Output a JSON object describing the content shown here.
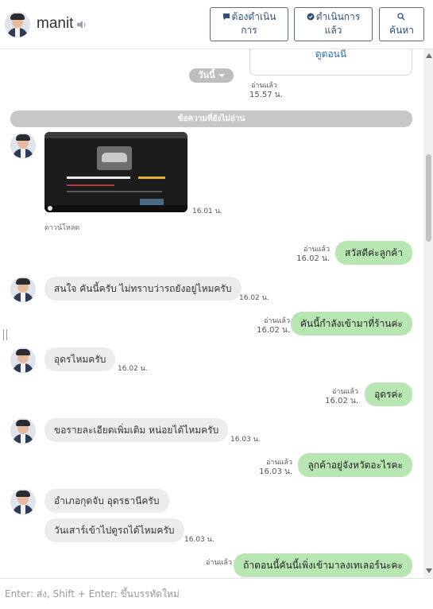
{
  "header": {
    "contact_name": "manit",
    "buttons": {
      "todo": [
        "ต้องดำเนิน",
        "การ"
      ],
      "done": [
        "ดำเนินการ",
        "แล้ว"
      ],
      "search": "ค้นหา"
    }
  },
  "chat": {
    "top_card_link": "ดูตอนนี้",
    "date_pill": "วันนี้",
    "top_read": "อ่านแล้ว",
    "top_time": "15.57 น.",
    "unread_divider": "ข้อความที่ยังไม่อ่าน",
    "image_time": "16.01 น.",
    "download_label": "ดาวน์โหลด",
    "messages": [
      {
        "text": "สวัสดีค่ะลูกค้า",
        "read": "อ่านแล้ว",
        "time": "16.02 น."
      },
      {
        "text": "สนใจ คันนี้ครับ ไม่ทราบว่ารถยังอยู่ไหมครับ",
        "time": "16.02 น."
      },
      {
        "text": "คันนี้กำลังเข้ามาที่ร้านค่ะ",
        "read": "อ่านแล้ว",
        "time": "16.02 น."
      },
      {
        "text": "อุดรไหมครับ",
        "time": "16.02 น."
      },
      {
        "text": "อุดรค่ะ",
        "read": "อ่านแล้ว",
        "time": "16.02 น."
      },
      {
        "text": "ขอรายละเอียดเพิ่มเติม หน่อยได้ไหมครับ",
        "time": "16.03 น."
      },
      {
        "text": "ลูกค้าอยู่จังหวัดอะไรคะ",
        "read": "อ่านแล้ว",
        "time": "16.03 น."
      },
      {
        "text": "อำเภอกุดจับ อุดรธานีครับ"
      },
      {
        "text": "วันเสาร์เข้าไปดูรถได้ไหมครับ",
        "time": "16.03 น."
      },
      {
        "text": "ถ้าตอนนี้คันนี้เพิ่งเข้ามาลงเทเลอร์นะคะ",
        "read": "อ่านแล้ว"
      }
    ]
  },
  "input": {
    "placeholder": "Enter: ส่ง, Shift + Enter: ขึ้นบรรทัดใหม่"
  },
  "colors": {
    "outgoing_bubble": "#b8e6b3",
    "incoming_bubble": "#ececec",
    "button_text": "#2f4f7a"
  }
}
